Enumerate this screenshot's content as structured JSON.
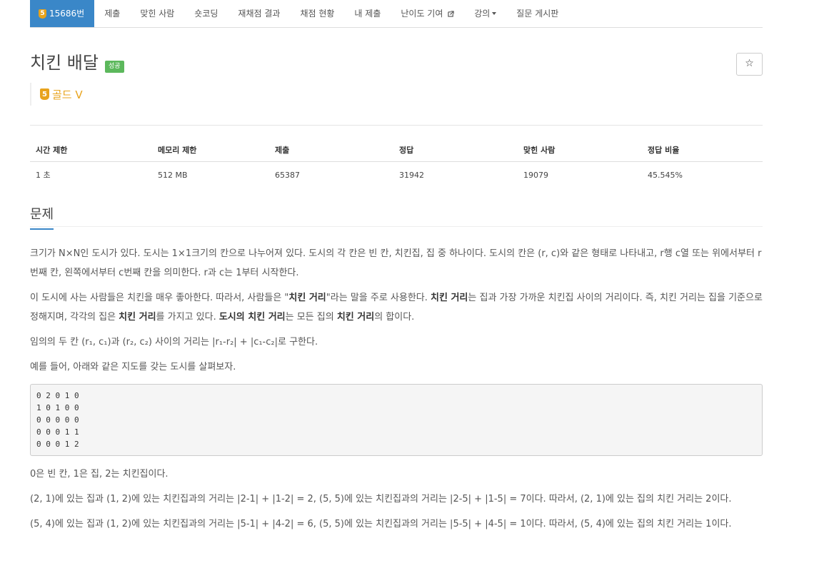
{
  "nav": {
    "problem_number": "15686번",
    "tier_number": "5",
    "items": [
      "제출",
      "맞힌 사람",
      "숏코딩",
      "재채점 결과",
      "채점 현황",
      "내 제출",
      "난이도 기여",
      "강의",
      "질문 게시판"
    ]
  },
  "header": {
    "title": "치킨 배달",
    "status_badge": "성공",
    "star": "☆",
    "tier_number": "5",
    "level_label": "골드 V"
  },
  "stats": {
    "headers": [
      "시간 제한",
      "메모리 제한",
      "제출",
      "정답",
      "맞힌 사람",
      "정답 비율"
    ],
    "values": [
      "1 초",
      "512 MB",
      "65387",
      "31942",
      "19079",
      "45.545%"
    ]
  },
  "section": {
    "title": "문제"
  },
  "content": {
    "p1": "크기가 N×N인 도시가 있다. 도시는 1×1크기의 칸으로 나누어져 있다. 도시의 각 칸은 빈 칸, 치킨집, 집 중 하나이다. 도시의 칸은 (r, c)와 같은 형태로 나타내고, r행 c열 또는 위에서부터 r번째 칸, 왼쪽에서부터 c번째 칸을 의미한다. r과 c는 1부터 시작한다.",
    "p2_a": "이 도시에 사는 사람들은 치킨을 매우 좋아한다. 따라서, 사람들은 \"",
    "p2_b": "치킨 거리",
    "p2_c": "\"라는 말을 주로 사용한다. ",
    "p2_d": "치킨 거리",
    "p2_e": "는 집과 가장 가까운 치킨집 사이의 거리이다. 즉, 치킨 거리는 집을 기준으로 정해지며, 각각의 집은 ",
    "p2_f": "치킨 거리",
    "p2_g": "를 가지고 있다. ",
    "p2_h": "도시의 치킨 거리",
    "p2_i": "는 모든 집의 ",
    "p2_j": "치킨 거리",
    "p2_k": "의 합이다.",
    "p3": "임의의 두 칸 (r₁, c₁)과 (r₂, c₂) 사이의 거리는 |r₁-r₂| + |c₁-c₂|로 구한다.",
    "p4": "예를 들어, 아래와 같은 지도를 갖는 도시를 살펴보자.",
    "grid": "0 2 0 1 0\n1 0 1 0 0\n0 0 0 0 0\n0 0 0 1 1\n0 0 0 1 2",
    "p5": "0은 빈 칸, 1은 집, 2는 치킨집이다.",
    "p6": "(2, 1)에 있는 집과 (1, 2)에 있는 치킨집과의 거리는 |2-1| + |1-2| = 2, (5, 5)에 있는 치킨집과의 거리는 |2-5| + |1-5| = 7이다. 따라서, (2, 1)에 있는 집의 치킨 거리는 2이다.",
    "p7": "(5, 4)에 있는 집과 (1, 2)에 있는 치킨집과의 거리는 |5-1| + |4-2| = 6, (5, 5)에 있는 치킨집과의 거리는 |5-5| + |4-5| = 1이다. 따라서, (5, 4)에 있는 집의 치킨 거리는 1이다."
  },
  "colors": {
    "accent": "#3a87c8",
    "gold": "#e8a31c",
    "success": "#5cb85c"
  }
}
